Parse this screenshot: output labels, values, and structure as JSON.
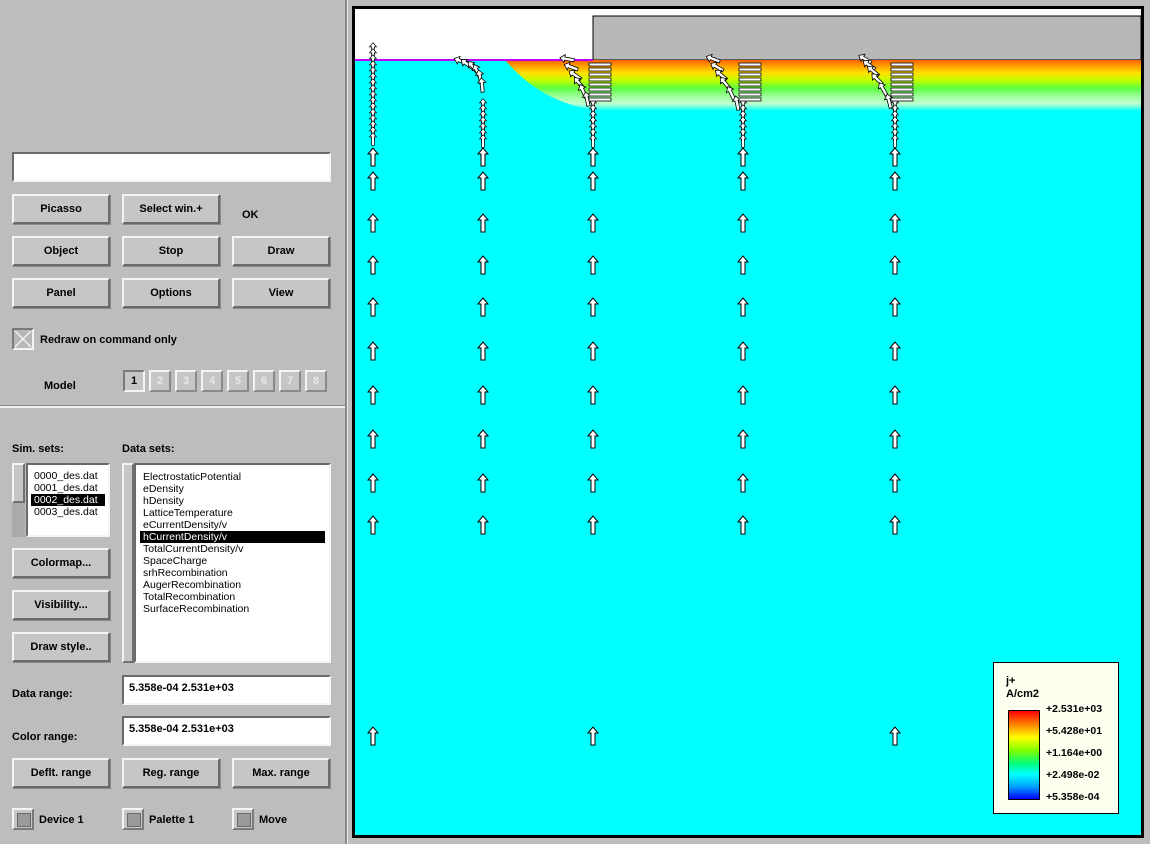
{
  "left": {
    "command_input": "",
    "buttons": {
      "picasso": "Picasso",
      "select_win": "Select win.+",
      "object": "Object",
      "stop": "Stop",
      "draw": "Draw",
      "panel": "Panel",
      "options": "Options",
      "view": "View"
    },
    "status": "OK",
    "redraw_label": "Redraw on command only",
    "model_label": "Model",
    "models": [
      "1",
      "2",
      "3",
      "4",
      "5",
      "6",
      "7",
      "8"
    ],
    "sim_sets_label": "Sim. sets:",
    "data_sets_label": "Data sets:",
    "sim_sets": [
      "0000_des.dat",
      "0001_des.dat",
      "0002_des.dat",
      "0003_des.dat"
    ],
    "sim_sets_selected": "0002_des.dat",
    "data_sets": [
      "ElectrostaticPotential",
      "eDensity",
      "hDensity",
      "LatticeTemperature",
      "eCurrentDensity/v",
      "hCurrentDensity/v",
      "TotalCurrentDensity/v",
      "SpaceCharge",
      "srhRecombination",
      "AugerRecombination",
      "TotalRecombination",
      "SurfaceRecombination"
    ],
    "data_sets_selected": "hCurrentDensity/v",
    "colormap_btn": "Colormap...",
    "visibility_btn": "Visibility...",
    "drawstyle_btn": "Draw style..",
    "data_range_label": "Data range:",
    "data_range_value": "5.358e-04  2.531e+03",
    "color_range_label": "Color range:",
    "color_range_value": "5.358e-04  2.531e+03",
    "deflt_range": "Deflt. range",
    "reg_range": "Reg. range",
    "max_range": "Max. range",
    "device_label": "Device 1",
    "palette_label": "Palette 1",
    "move_label": "Move"
  },
  "plot": {
    "colors": {
      "background": "#00ffff",
      "contact": "#b8b8b8",
      "oxide": "#ffffff",
      "surface_line": "#c000ff"
    },
    "legend": {
      "title": "j+",
      "unit": "A/cm2",
      "ticks": [
        "+2.531e+03",
        "+5.428e+01",
        "+1.164e+00",
        "+2.498e-02",
        "+5.358e-04"
      ]
    }
  }
}
